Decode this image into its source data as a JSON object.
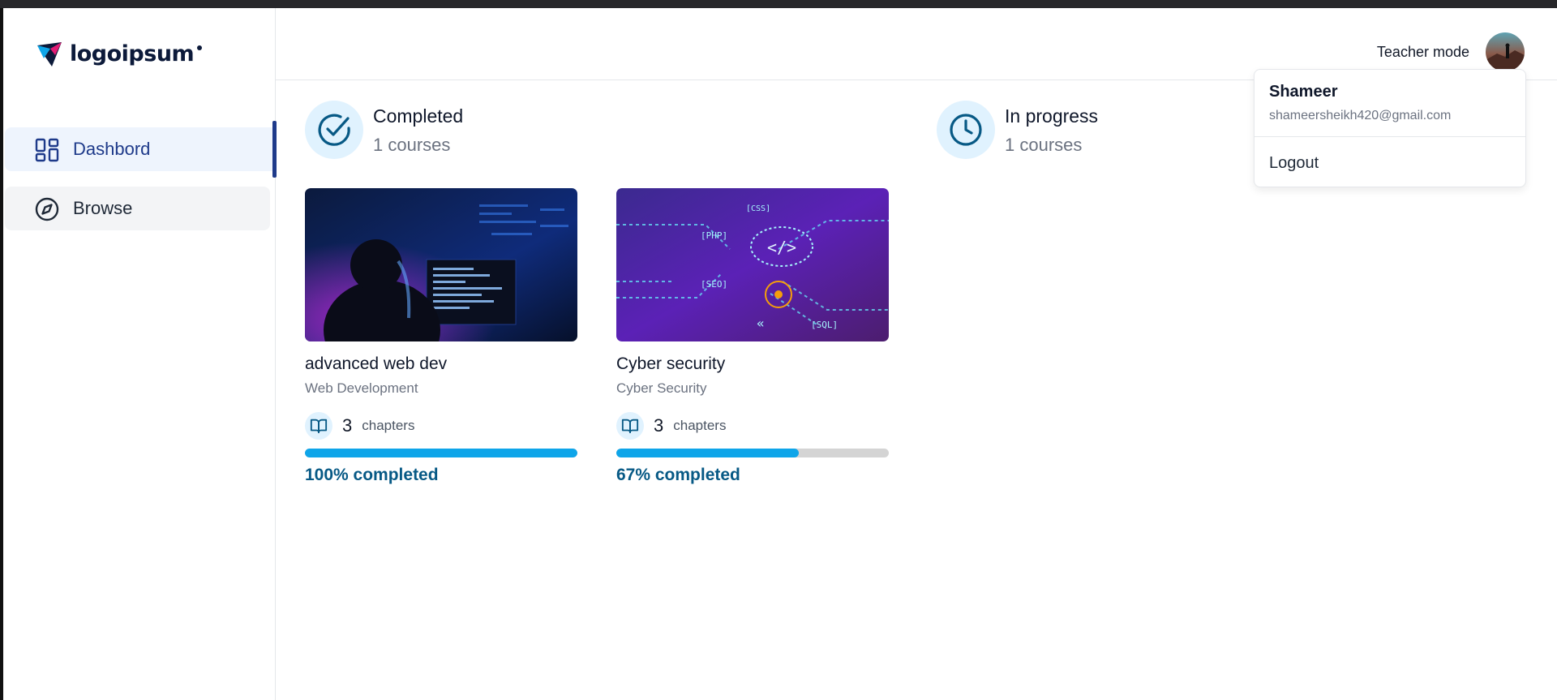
{
  "brand": {
    "name": "logoipsum"
  },
  "sidebar": {
    "items": [
      {
        "label": "Dashbord",
        "icon": "layout-grid-icon",
        "active": true
      },
      {
        "label": "Browse",
        "icon": "compass-icon",
        "active": false
      }
    ]
  },
  "header": {
    "teacher_mode": "Teacher mode"
  },
  "dropdown": {
    "name": "Shameer",
    "email": "shameersheikh420@gmail.com",
    "logout": "Logout"
  },
  "stats": {
    "completed": {
      "title": "Completed",
      "count": "1 courses",
      "icon": "check-circle-icon"
    },
    "in_progress": {
      "title": "In progress",
      "count": "1 courses",
      "icon": "clock-icon"
    }
  },
  "courses": [
    {
      "title": "advanced web dev",
      "category": "Web Development",
      "chapters_count": "3",
      "chapters_label": "chapters",
      "progress": 100,
      "progress_text": "100% completed"
    },
    {
      "title": "Cyber security",
      "category": "Cyber Security",
      "chapters_count": "3",
      "chapters_label": "chapters",
      "progress": 67,
      "progress_text": "67% completed"
    }
  ],
  "colors": {
    "accent": "#0ea5e9",
    "brand_dark": "#1e3a8a",
    "stat_icon": "#075985",
    "progress_text": "#075985"
  }
}
